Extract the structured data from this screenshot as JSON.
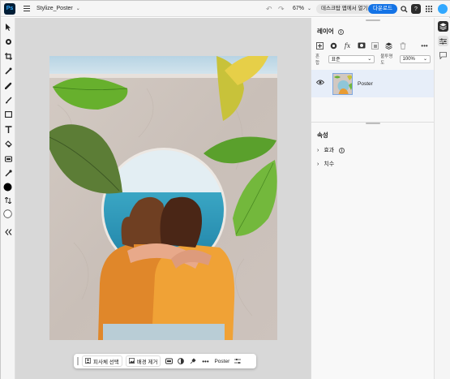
{
  "app": {
    "logo_text": "Ps",
    "document_name": "Stylize_Poster"
  },
  "topbar": {
    "zoom_value": "67%",
    "open_in_app_label": "데스크탑 앱에서 열기",
    "download_label": "다운로드",
    "help_label": "?"
  },
  "floatbar": {
    "select_subject_label": "피사체 선택",
    "remove_bg_label": "배경 제거",
    "more_label": "•••",
    "layer_label": "Poster"
  },
  "layers_panel": {
    "title": "레이어",
    "blend_label": "혼합",
    "blend_value": "표준",
    "opacity_label": "불투명도",
    "opacity_value": "100%",
    "more_label": "•••",
    "layers": [
      {
        "name": "Poster",
        "visible": true,
        "selected": true
      }
    ]
  },
  "properties_panel": {
    "title": "속성",
    "sections": [
      {
        "label": "효과",
        "has_info": true
      },
      {
        "label": "치수",
        "has_info": false
      }
    ]
  },
  "colors": {
    "accent": "#1473e6",
    "foreground_swatch": "#000000",
    "background_swatch": "#ffffff",
    "canvas_bg": "#d8d8d8",
    "selected_layer_bg": "#e7eef9"
  },
  "left_tools": [
    "move-tool",
    "lasso-tool",
    "crop-tool",
    "quick-select-tool",
    "healing-tool",
    "brush-tool",
    "rectangle-tool",
    "type-tool",
    "fill-tool",
    "adjust-tool",
    "eyedropper-tool"
  ],
  "icons": [
    "hamburger-icon",
    "chevron-down-icon",
    "undo-icon",
    "redo-icon",
    "search-icon",
    "help-icon",
    "apps-grid-icon",
    "layers-icon",
    "properties-icon",
    "comments-icon",
    "eye-icon",
    "collapse-icon",
    "swap-colors-icon"
  ]
}
